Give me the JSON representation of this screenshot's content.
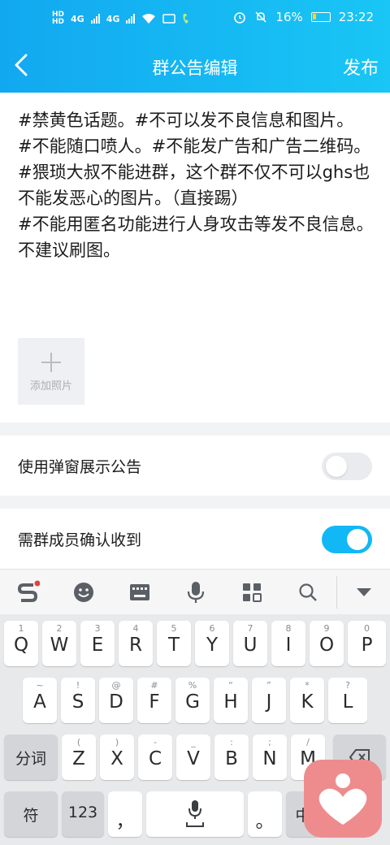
{
  "status": {
    "network_left": "4G",
    "network_right": "4G",
    "battery": "16%",
    "time": "23:22"
  },
  "nav": {
    "title": "群公告编辑",
    "publish": "发布"
  },
  "announcement": {
    "lines": [
      "#禁黄色话题。#不可以发不良信息和图片。",
      "#不能随口喷人。#不能发广告和广告二维码。",
      "#猥琐大叔不能进群，这个群不仅不可以ghs也不能发恶心的图片。（直接踢）",
      "#不能用匿名功能进行人身攻击等发不良信息。",
      "不建议刷图。"
    ],
    "add_photo": "添加照片"
  },
  "settings": {
    "popup": {
      "label": "使用弹窗展示公告",
      "enabled": false
    },
    "confirm": {
      "label": "需群成员确认收到",
      "enabled": true
    }
  },
  "keyboard": {
    "row1": [
      {
        "main": "Q",
        "sub": "1"
      },
      {
        "main": "W",
        "sub": "2"
      },
      {
        "main": "E",
        "sub": "3"
      },
      {
        "main": "R",
        "sub": "4"
      },
      {
        "main": "T",
        "sub": "5"
      },
      {
        "main": "Y",
        "sub": "6"
      },
      {
        "main": "U",
        "sub": "7"
      },
      {
        "main": "I",
        "sub": "8"
      },
      {
        "main": "O",
        "sub": "9"
      },
      {
        "main": "P",
        "sub": "0"
      }
    ],
    "row2": [
      {
        "main": "A",
        "sub": "~"
      },
      {
        "main": "S",
        "sub": "!"
      },
      {
        "main": "D",
        "sub": "@"
      },
      {
        "main": "F",
        "sub": "#"
      },
      {
        "main": "G",
        "sub": "%"
      },
      {
        "main": "H",
        "sub": "“"
      },
      {
        "main": "J",
        "sub": "”"
      },
      {
        "main": "K",
        "sub": "*"
      },
      {
        "main": "L",
        "sub": "?"
      }
    ],
    "row3": [
      {
        "main": "Z",
        "sub": "("
      },
      {
        "main": "X",
        "sub": ")"
      },
      {
        "main": "C",
        "sub": "-"
      },
      {
        "main": "V",
        "sub": "_"
      },
      {
        "main": "B",
        "sub": ":"
      },
      {
        "main": "N",
        "sub": ";"
      },
      {
        "main": "M",
        "sub": "/"
      }
    ],
    "fenci": "分词",
    "symbols": "符",
    "numbers": "123",
    "comma": "，",
    "period": "。",
    "lang": "中"
  },
  "colors": {
    "accent": "#12b7f5",
    "header_start": "#12a8f0",
    "header_end": "#19c6f5",
    "overlay_app": "#ee8c8d"
  }
}
